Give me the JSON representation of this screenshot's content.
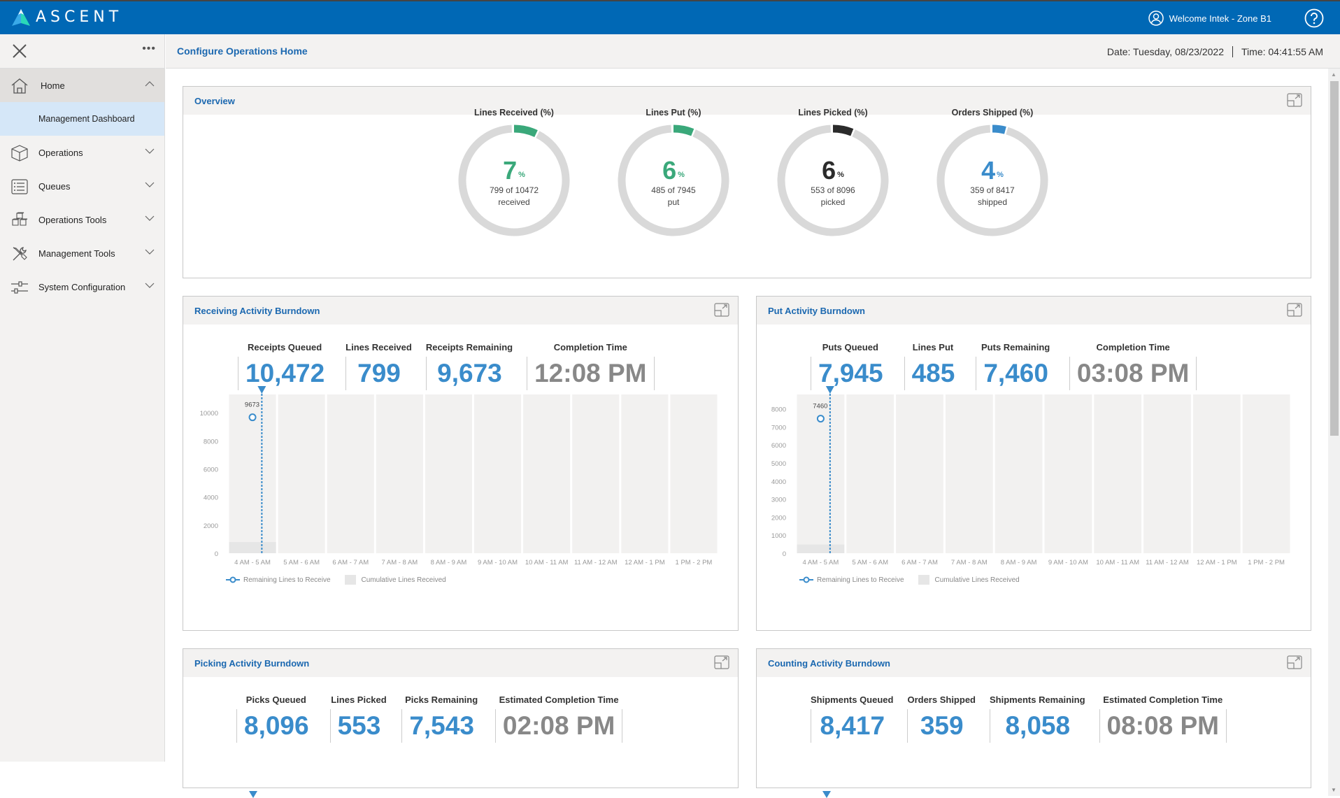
{
  "header": {
    "brand": "ASCENT",
    "welcome": "Welcome Intek - Zone B1",
    "brand_color": "#0068b5"
  },
  "sidebar": {
    "items": [
      {
        "label": "Home",
        "icon": "home-icon",
        "expanded": true,
        "children": [
          {
            "label": "Management Dashboard",
            "selected": true
          }
        ]
      },
      {
        "label": "Operations",
        "icon": "box-icon"
      },
      {
        "label": "Queues",
        "icon": "list-icon"
      },
      {
        "label": "Operations Tools",
        "icon": "boxes-icon"
      },
      {
        "label": "Management Tools",
        "icon": "tools-icon"
      },
      {
        "label": "System Configuration",
        "icon": "sliders-icon"
      }
    ]
  },
  "page": {
    "title": "Configure Operations Home",
    "date": "Date: Tuesday, 08/23/2022",
    "time": "Time: 04:41:55 AM"
  },
  "overview": {
    "title": "Overview",
    "gauges": [
      {
        "title": "Lines Received (%)",
        "pct": "7",
        "pct_value": 7,
        "detail": "799 of 10472",
        "unit": "received",
        "color": "#3aa87a"
      },
      {
        "title": "Lines Put (%)",
        "pct": "6",
        "pct_value": 6,
        "detail": "485 of 7945",
        "unit": "put",
        "color": "#3aa87a"
      },
      {
        "title": "Lines Picked (%)",
        "pct": "6",
        "pct_value": 6,
        "detail": "553 of 8096",
        "unit": "picked",
        "color": "#2b2b2b"
      },
      {
        "title": "Orders Shipped (%)",
        "pct": "4",
        "pct_value": 4,
        "detail": "359 of 8417",
        "unit": "shipped",
        "color": "#3a8ccb"
      }
    ],
    "pct_sign": "%"
  },
  "cards": {
    "receiving": {
      "title": "Receiving Activity Burndown",
      "kpis": [
        {
          "label": "Receipts Queued",
          "value": "10,472"
        },
        {
          "label": "Lines Received",
          "value": "799"
        },
        {
          "label": "Receipts Remaining",
          "value": "9,673"
        },
        {
          "label": "Completion Time",
          "value": "12:08 PM"
        }
      ]
    },
    "put": {
      "title": "Put Activity Burndown",
      "kpis": [
        {
          "label": "Puts Queued",
          "value": "7,945"
        },
        {
          "label": "Lines Put",
          "value": "485"
        },
        {
          "label": "Puts Remaining",
          "value": "7,460"
        },
        {
          "label": "Completion Time",
          "value": "03:08 PM"
        }
      ]
    },
    "picking": {
      "title": "Picking Activity Burndown",
      "kpis": [
        {
          "label": "Picks Queued",
          "value": "8,096"
        },
        {
          "label": "Lines Picked",
          "value": "553"
        },
        {
          "label": "Picks Remaining",
          "value": "7,543"
        },
        {
          "label": "Estimated Completion Time",
          "value": "02:08 PM"
        }
      ]
    },
    "counting": {
      "title": "Counting Activity Burndown",
      "kpis": [
        {
          "label": "Shipments Queued",
          "value": "8,417"
        },
        {
          "label": "Orders Shipped",
          "value": "359"
        },
        {
          "label": "Shipments Remaining",
          "value": "8,058"
        },
        {
          "label": "Estimated Completion Time",
          "value": "08:08 PM"
        }
      ]
    }
  },
  "chart_data": [
    {
      "type": "bar",
      "title": "Receiving Activity Burndown",
      "categories": [
        "4 AM - 5 AM",
        "5 AM - 6 AM",
        "6 AM - 7 AM",
        "7 AM - 8 AM",
        "8 AM - 9 AM",
        "9 AM - 10 AM",
        "10 AM - 11 AM",
        "11 AM - 12 AM",
        "12 AM - 1 PM",
        "1 PM - 2 PM"
      ],
      "series": [
        {
          "name": "Remaining Lines to Receive",
          "kind": "line",
          "values": [
            9673,
            null,
            null,
            null,
            null,
            null,
            null,
            null,
            null,
            null
          ],
          "color": "#3a8ccb"
        },
        {
          "name": "Cumulative Lines Received",
          "kind": "bar",
          "values": [
            799,
            null,
            null,
            null,
            null,
            null,
            null,
            null,
            null,
            null
          ],
          "color": "#e6e6e6"
        }
      ],
      "point_labels": [
        "9673"
      ],
      "yticks": [
        0,
        2000,
        4000,
        6000,
        8000,
        10000
      ],
      "ylim": [
        0,
        11300
      ],
      "current_marker_index": 0,
      "legend": "bottom-left"
    },
    {
      "type": "bar",
      "title": "Put Activity Burndown",
      "categories": [
        "4 AM - 5 AM",
        "5 AM - 6 AM",
        "6 AM - 7 AM",
        "7 AM - 8 AM",
        "8 AM - 9 AM",
        "9 AM - 10 AM",
        "10 AM - 11 AM",
        "11 AM - 12 AM",
        "12 AM - 1 PM",
        "1 PM - 2 PM"
      ],
      "series": [
        {
          "name": "Remaining Lines to Receive",
          "kind": "line",
          "values": [
            7460,
            null,
            null,
            null,
            null,
            null,
            null,
            null,
            null,
            null
          ],
          "color": "#3a8ccb"
        },
        {
          "name": "Cumulative Lines Received",
          "kind": "bar",
          "values": [
            485,
            null,
            null,
            null,
            null,
            null,
            null,
            null,
            null,
            null
          ],
          "color": "#e6e6e6"
        }
      ],
      "point_labels": [
        "7460"
      ],
      "yticks": [
        0,
        1000,
        2000,
        3000,
        4000,
        5000,
        6000,
        7000,
        8000
      ],
      "ylim": [
        0,
        8800
      ],
      "current_marker_index": 0,
      "legend": "bottom-left"
    }
  ]
}
